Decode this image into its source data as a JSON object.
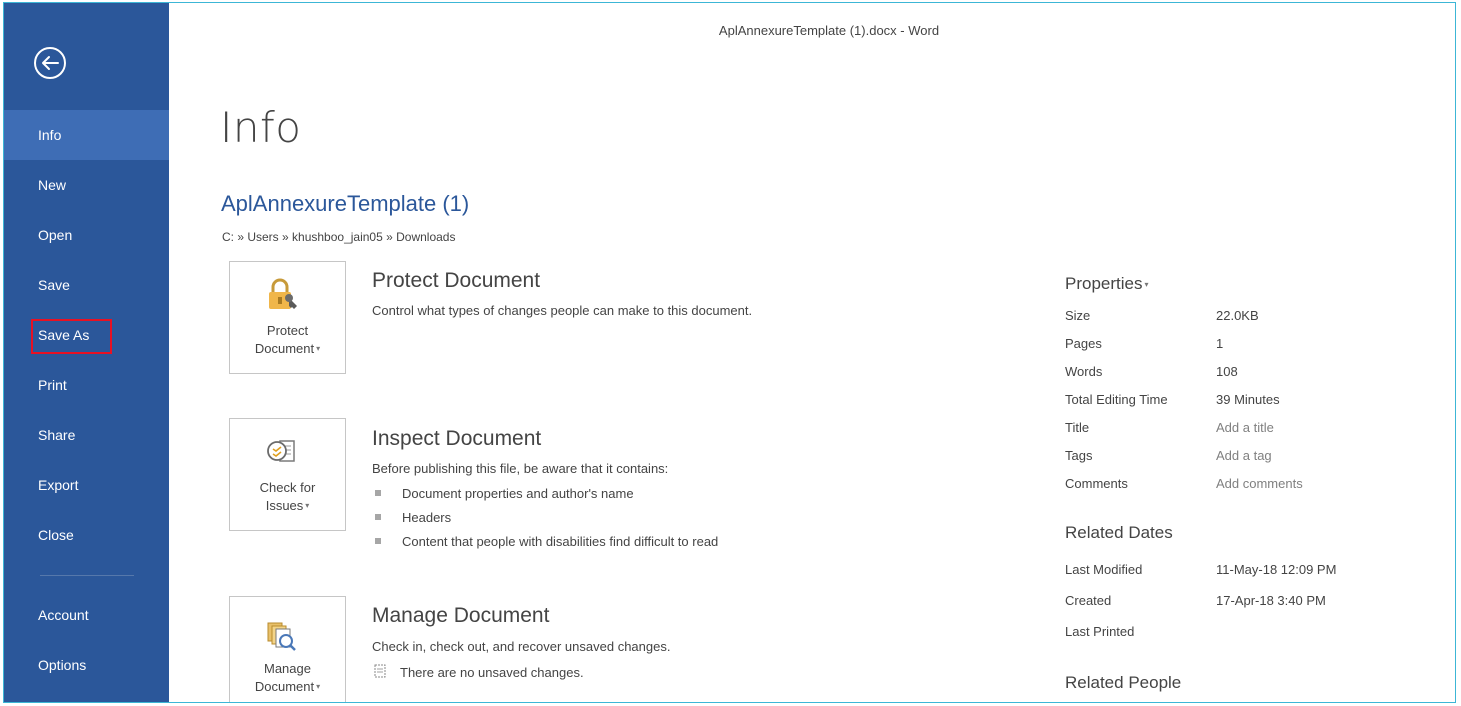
{
  "window": {
    "title": "AplAnnexureTemplate (1).docx - Word"
  },
  "sidebar": {
    "back_icon": "back-arrow-circle-icon",
    "items": [
      {
        "label": "Info",
        "active": true
      },
      {
        "label": "New"
      },
      {
        "label": "Open"
      },
      {
        "label": "Save"
      },
      {
        "label": "Save As",
        "highlighted": true
      },
      {
        "label": "Print"
      },
      {
        "label": "Share"
      },
      {
        "label": "Export"
      },
      {
        "label": "Close"
      },
      {
        "label": "Account"
      },
      {
        "label": "Options"
      }
    ]
  },
  "main": {
    "title": "Info",
    "doc_name": "AplAnnexureTemplate (1)",
    "doc_path": "C: » Users » khushboo_jain05 » Downloads",
    "protect": {
      "tile_line1": "Protect",
      "tile_line2": "Document",
      "title": "Protect Document",
      "desc": "Control what types of changes people can make to this document."
    },
    "inspect": {
      "tile_line1": "Check for",
      "tile_line2": "Issues",
      "title": "Inspect Document",
      "desc": "Before publishing this file, be aware that it contains:",
      "bullets": [
        "Document properties and author's name",
        "Headers",
        "Content that people with disabilities find difficult to read"
      ]
    },
    "manage": {
      "tile_line1": "Manage",
      "tile_line2": "Document",
      "title": "Manage Document",
      "desc": "Check in, check out, and recover unsaved changes.",
      "status": "There are no unsaved changes."
    }
  },
  "properties": {
    "header": "Properties",
    "rows": [
      {
        "label": "Size",
        "value": "22.0KB"
      },
      {
        "label": "Pages",
        "value": "1"
      },
      {
        "label": "Words",
        "value": "108"
      },
      {
        "label": "Total Editing Time",
        "value": "39 Minutes"
      },
      {
        "label": "Title",
        "value": "Add a title"
      },
      {
        "label": "Tags",
        "value": "Add a tag"
      },
      {
        "label": "Comments",
        "value": "Add comments"
      }
    ],
    "related_dates": {
      "header": "Related Dates",
      "rows": [
        {
          "label": "Last Modified",
          "value": "11-May-18 12:09 PM"
        },
        {
          "label": "Created",
          "value": "17-Apr-18 3:40 PM"
        },
        {
          "label": "Last Printed",
          "value": ""
        }
      ]
    },
    "related_people": {
      "header": "Related People"
    }
  },
  "colors": {
    "sidebar_bg": "#2b579a",
    "sidebar_active": "#3e6db5",
    "accent_text": "#2b579a",
    "highlight_border": "#e81123",
    "window_border": "#3cb6d6"
  }
}
